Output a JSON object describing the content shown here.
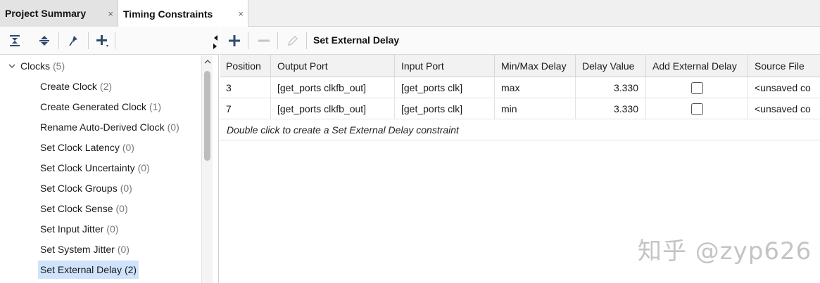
{
  "tabs": [
    {
      "label": "Project Summary",
      "active": false
    },
    {
      "label": "Timing Constraints",
      "active": true
    }
  ],
  "tab_close_glyph": "×",
  "left_toolbar": {
    "buttons": [
      "collapse-all-icon",
      "expand-all-icon",
      "pin-icon",
      "add-icon"
    ]
  },
  "tree": {
    "group": {
      "label": "Clocks",
      "count": "(5)"
    },
    "items": [
      {
        "label": "Create Clock",
        "count": "(2)"
      },
      {
        "label": "Create Generated Clock",
        "count": "(1)"
      },
      {
        "label": "Rename Auto-Derived Clock",
        "count": "(0)"
      },
      {
        "label": "Set Clock Latency",
        "count": "(0)"
      },
      {
        "label": "Set Clock Uncertainty",
        "count": "(0)"
      },
      {
        "label": "Set Clock Groups",
        "count": "(0)"
      },
      {
        "label": "Set Clock Sense",
        "count": "(0)"
      },
      {
        "label": "Set Input Jitter",
        "count": "(0)"
      },
      {
        "label": "Set System Jitter",
        "count": "(0)"
      },
      {
        "label": "Set External Delay",
        "count": "(2)",
        "selected": true
      }
    ]
  },
  "right_toolbar": {
    "title": "Set External Delay",
    "buttons": [
      "add-icon",
      "remove-icon",
      "edit-icon"
    ]
  },
  "table": {
    "columns": [
      "Position",
      "Output Port",
      "Input Port",
      "Min/Max Delay",
      "Delay Value",
      "Add External Delay",
      "Source File"
    ],
    "rows": [
      {
        "position": "3",
        "output_port": "[get_ports clkfb_out]",
        "input_port": "[get_ports clk]",
        "minmax": "max",
        "delay_value": "3.330",
        "add_external_delay": false,
        "source_file": "<unsaved co"
      },
      {
        "position": "7",
        "output_port": "[get_ports clkfb_out]",
        "input_port": "[get_ports clk]",
        "minmax": "min",
        "delay_value": "3.330",
        "add_external_delay": false,
        "source_file": "<unsaved co"
      }
    ],
    "hint": "Double click to create a Set External Delay constraint"
  },
  "watermark": "知乎 @zyp626",
  "colors": {
    "selection": "#cfe3fb",
    "icon": "#2f4a6b"
  }
}
